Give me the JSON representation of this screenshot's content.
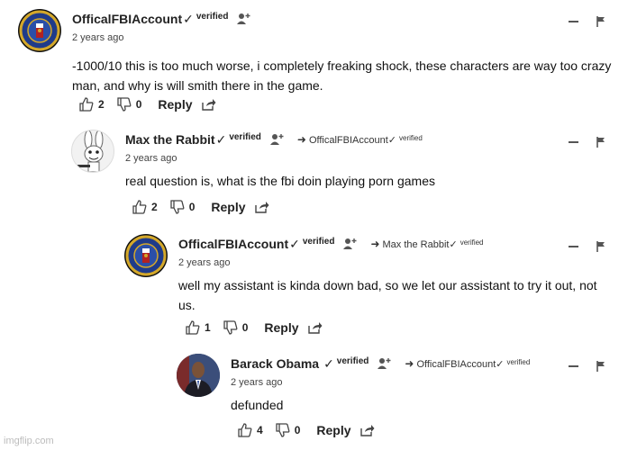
{
  "comments": [
    {
      "author": "OfficalFBIAccount",
      "check": "✓",
      "verified": "verified",
      "reply_to": "",
      "time": "2 years ago",
      "text": "-1000/10 this is too much worse, i completely freaking shock, these characters are way too crazy man, and why is will smith there in the game.",
      "likes": "2",
      "dislikes": "0",
      "reply_label": "Reply"
    },
    {
      "author": "Max the Rabbit",
      "check": "✓",
      "verified": "verified",
      "reply_to": "OfficalFBIAccount✓",
      "reply_to_verified": "verified",
      "time": "2 years ago",
      "text": "real question is, what is the fbi doin playing porn games",
      "likes": "2",
      "dislikes": "0",
      "reply_label": "Reply"
    },
    {
      "author": "OfficalFBIAccount",
      "check": "✓",
      "verified": "verified",
      "reply_to": "Max the Rabbit✓",
      "reply_to_verified": "verified",
      "time": "2 years ago",
      "text": "well my assistant is kinda down bad, so we let our assistant to try it out, not us.",
      "likes": "1",
      "dislikes": "0",
      "reply_label": "Reply"
    },
    {
      "author": "Barack Obama",
      "check": "✓",
      "verified": "verified",
      "reply_to": "OfficalFBIAccount✓",
      "reply_to_verified": "verified",
      "time": "2 years ago",
      "text": "defunded",
      "likes": "4",
      "dislikes": "0",
      "reply_label": "Reply"
    }
  ],
  "watermark": "imgflip.com",
  "colors": {
    "text": "#111111",
    "muted": "#444444",
    "fbi_blue": "#1f3b8a",
    "fbi_gold": "#d4a82a"
  },
  "icons": [
    "follow-icon",
    "reply-arrow-icon",
    "thumbs-up-icon",
    "thumbs-down-icon",
    "share-icon",
    "collapse-icon",
    "flag-icon"
  ]
}
